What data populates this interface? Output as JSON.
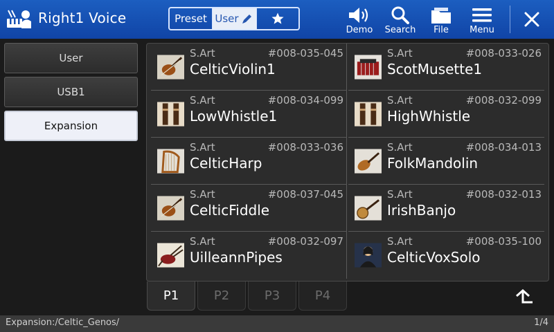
{
  "header": {
    "title": "Right1 Voice",
    "tabs": {
      "preset": "Preset",
      "user": "User",
      "favorite_icon": "star-icon"
    },
    "buttons": {
      "demo": "Demo",
      "search": "Search",
      "file": "File",
      "menu": "Menu"
    }
  },
  "sidebar": {
    "items": [
      {
        "label": "User",
        "active": false
      },
      {
        "label": "USB1",
        "active": false
      },
      {
        "label": "Expansion",
        "active": true
      }
    ]
  },
  "voices": [
    {
      "category": "S.Art",
      "number": "#008-035-045",
      "name": "CelticViolin1",
      "icon": "violin-icon"
    },
    {
      "category": "S.Art",
      "number": "#008-033-026",
      "name": "ScotMusette1",
      "icon": "accordion-icon"
    },
    {
      "category": "S.Art",
      "number": "#008-034-099",
      "name": "LowWhistle1",
      "icon": "whistle-icon"
    },
    {
      "category": "S.Art",
      "number": "#008-032-099",
      "name": "HighWhistle",
      "icon": "whistle-icon"
    },
    {
      "category": "S.Art",
      "number": "#008-033-036",
      "name": "CelticHarp",
      "icon": "harp-icon"
    },
    {
      "category": "S.Art",
      "number": "#008-034-013",
      "name": "FolkMandolin",
      "icon": "mandolin-icon"
    },
    {
      "category": "S.Art",
      "number": "#008-037-045",
      "name": "CelticFiddle",
      "icon": "violin-icon"
    },
    {
      "category": "S.Art",
      "number": "#008-032-013",
      "name": "IrishBanjo",
      "icon": "banjo-icon"
    },
    {
      "category": "S.Art",
      "number": "#008-032-097",
      "name": "UilleannPipes",
      "icon": "bagpipes-icon"
    },
    {
      "category": "S.Art",
      "number": "#008-035-100",
      "name": "CelticVoxSolo",
      "icon": "vocalist-icon"
    }
  ],
  "pages": {
    "tabs": [
      "P1",
      "P2",
      "P3",
      "P4"
    ],
    "active": 0
  },
  "status": {
    "path": "Expansion:/Celtic_Genos/",
    "page_indicator": "1/4"
  },
  "colors": {
    "header": "#1551b4",
    "background": "#1b1b1b",
    "panel": "#2c2c2c",
    "accent_text": "#2556b0"
  }
}
